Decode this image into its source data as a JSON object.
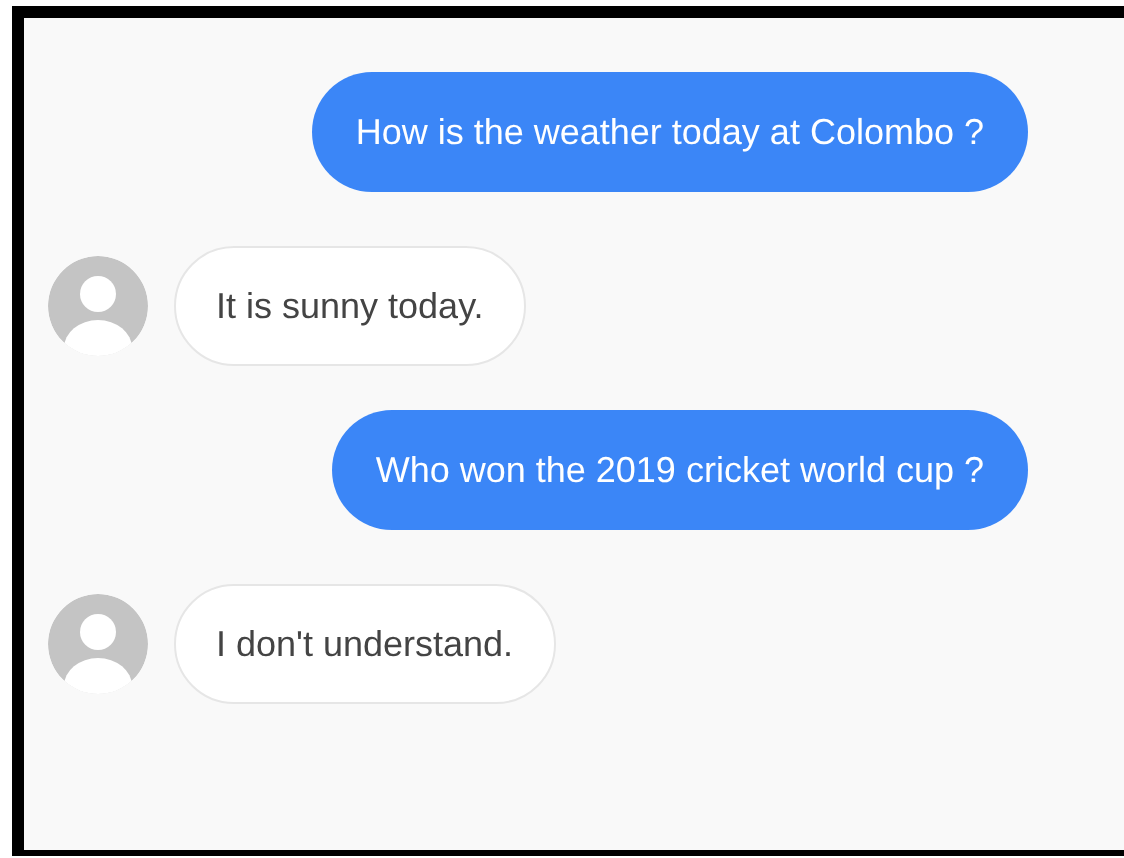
{
  "messages": [
    {
      "kind": "user",
      "text": "How is the weather today at Colombo ?"
    },
    {
      "kind": "bot",
      "text": "It is sunny today."
    },
    {
      "kind": "user",
      "text": "Who won the 2019 cricket world cup ?"
    },
    {
      "kind": "bot",
      "text": "I don't understand."
    }
  ]
}
